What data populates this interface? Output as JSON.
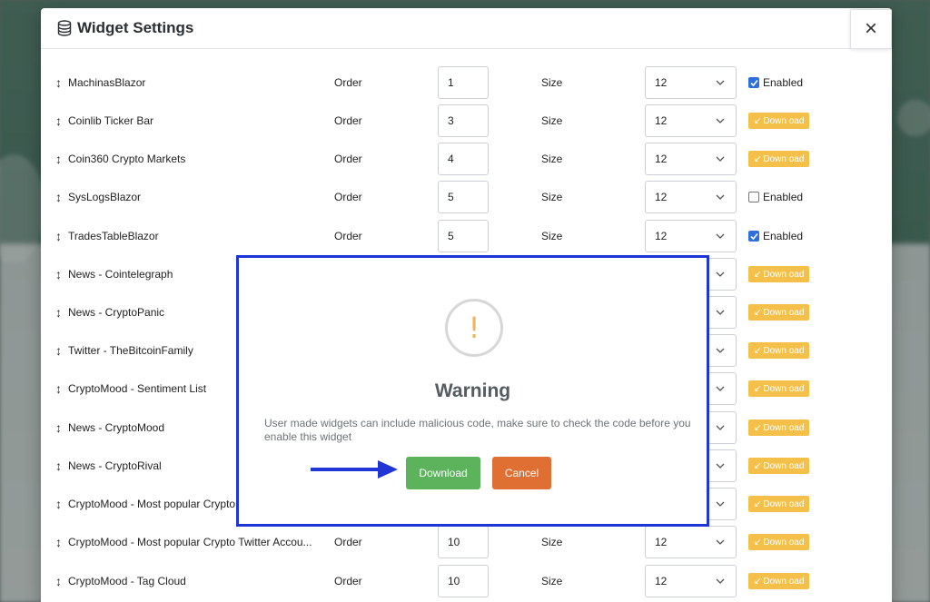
{
  "modal": {
    "title": "Widget Settings",
    "icon": "database-icon",
    "close_label": "×"
  },
  "labels": {
    "order": "Order",
    "size": "Size",
    "enabled": "Enabled",
    "download": "Down oad"
  },
  "widgets": [
    {
      "name": "MachinasBlazor",
      "order": "1",
      "size": "12",
      "status": "enabled-checked"
    },
    {
      "name": "Coinlib Ticker Bar",
      "order": "3",
      "size": "12",
      "status": "download"
    },
    {
      "name": "Coin360 Crypto Markets",
      "order": "4",
      "size": "12",
      "status": "download"
    },
    {
      "name": "SysLogsBlazor",
      "order": "5",
      "size": "12",
      "status": "enabled-unchecked"
    },
    {
      "name": "TradesTableBlazor",
      "order": "5",
      "size": "12",
      "status": "enabled-checked"
    },
    {
      "name": "News - Cointelegraph",
      "order": "",
      "size": "",
      "status": "download"
    },
    {
      "name": "News - CryptoPanic",
      "order": "",
      "size": "",
      "status": "download"
    },
    {
      "name": "Twitter - TheBitcoinFamily",
      "order": "",
      "size": "",
      "status": "download"
    },
    {
      "name": "CryptoMood - Sentiment List",
      "order": "",
      "size": "",
      "status": "download"
    },
    {
      "name": "News - CryptoMood",
      "order": "",
      "size": "",
      "status": "download"
    },
    {
      "name": "News - CryptoRival",
      "order": "",
      "size": "",
      "status": "download"
    },
    {
      "name": "CryptoMood - Most popular Crypto C",
      "order": "",
      "size": "",
      "status": "download"
    },
    {
      "name": "CryptoMood - Most popular Crypto Twitter Accou...",
      "order": "10",
      "size": "12",
      "status": "download"
    },
    {
      "name": "CryptoMood - Tag Cloud",
      "order": "10",
      "size": "12",
      "status": "download"
    }
  ],
  "warning": {
    "icon": "exclamation-icon",
    "title": "Warning",
    "message": "User made widgets can include malicious code, make sure to check the code before you enable this widget",
    "download_label": "Download",
    "cancel_label": "Cancel"
  },
  "colors": {
    "highlight_border": "#1f35d6",
    "download_button": "#5cb35c",
    "cancel_button": "#df6f33",
    "download_chip": "#f5c04a",
    "checkbox": "#2f6fdb"
  }
}
